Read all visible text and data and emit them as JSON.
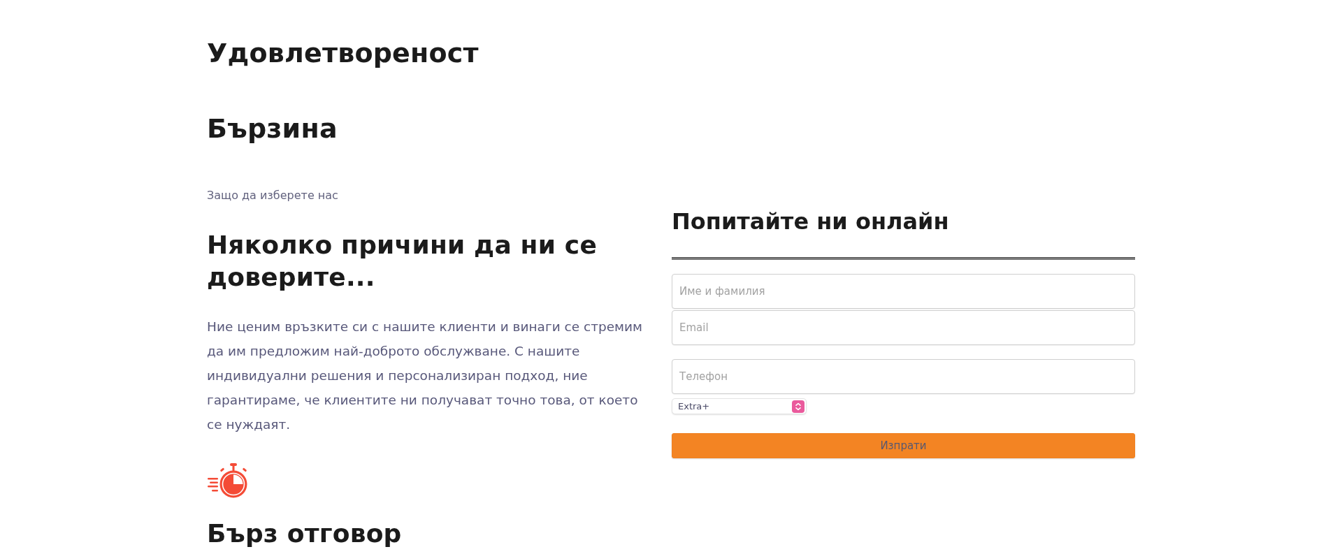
{
  "content": [
    {
      "kind": "heading",
      "text": "Удовлетвореност"
    },
    {
      "kind": "heading",
      "text": "Бързина"
    },
    {
      "kind": "eyebrow",
      "text": "Защо да изберете нас"
    },
    {
      "kind": "heading",
      "text": "Няколко причини да ни се доверите..."
    },
    {
      "kind": "paragraph",
      "text": "Ние ценим връзките си с нашите клиенти и винаги се стремим да им предложим най-доброто обслужване. С нашите индивидуални решения и персонализиран подход, ние гарантираме, че клиентите ни получават точно това, от което се нуждаят."
    },
    {
      "kind": "feature",
      "title": "Бърз отговор"
    }
  ],
  "contact_form": {
    "title": "Попитайте ни онлайн",
    "fields": [
      {
        "placeholder": "Име и фамилия"
      },
      {
        "placeholder": "Email"
      },
      {
        "placeholder": "Телефон"
      }
    ],
    "plan": {
      "value": "Extra+"
    },
    "submit": "Изпрати"
  }
}
